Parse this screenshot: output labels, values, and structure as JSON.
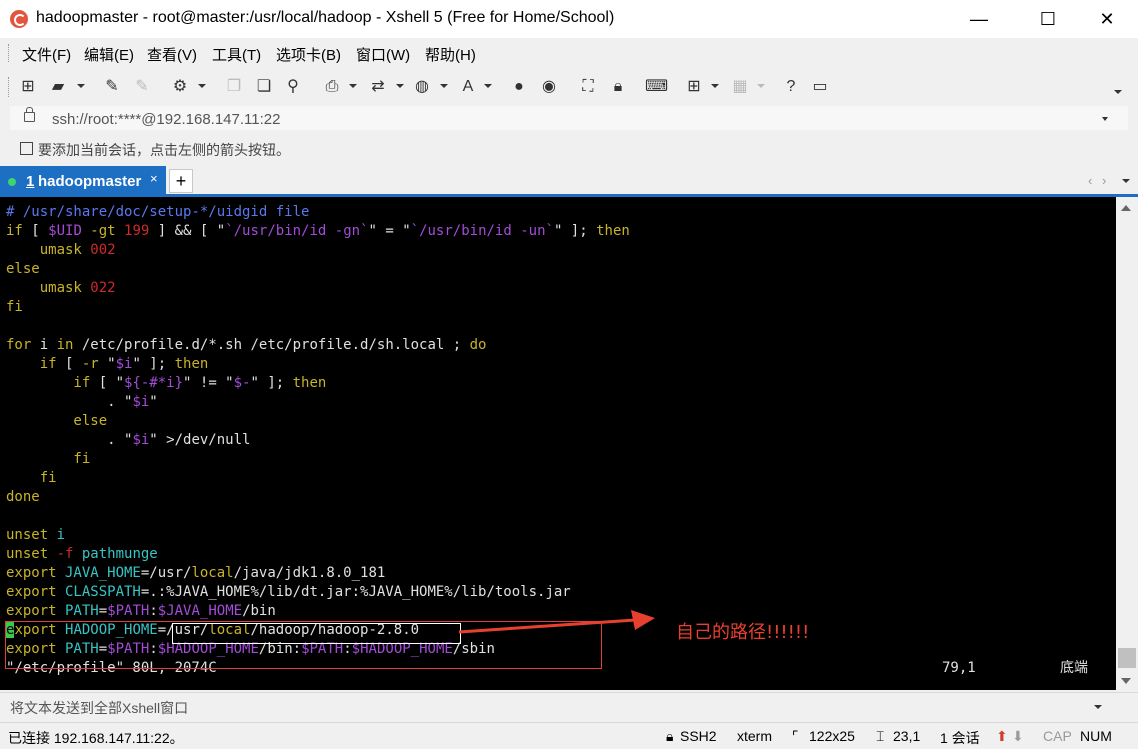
{
  "window": {
    "title": "hadoopmaster - root@master:/usr/local/hadoop - Xshell 5 (Free for Home/School)",
    "minimize": "—",
    "maximize": "☐",
    "close": "✕"
  },
  "menu": [
    "文件(F)",
    "编辑(E)",
    "查看(V)",
    "工具(T)",
    "选项卡(B)",
    "窗口(W)",
    "帮助(H)"
  ],
  "toolbar_icons": [
    "new-session-icon",
    "open-folder-icon",
    "reconnect-icon",
    "disconnect-icon",
    "properties-icon",
    "copy-icon",
    "paste-icon",
    "find-icon",
    "print-icon",
    "transfer-icon",
    "globe-icon",
    "font-icon",
    "xftp-icon",
    "xmanager-icon",
    "fullscreen-icon",
    "lock-icon",
    "keyboard-icon",
    "add-tab-icon",
    "layout-icon",
    "help-icon",
    "chat-icon"
  ],
  "address": {
    "text": "ssh://root:****@192.168.147.11:22"
  },
  "hint": {
    "text": "要添加当前会话，点击左侧的箭头按钮。"
  },
  "tab": {
    "number": "1",
    "label": "hadoopmaster",
    "close": "×",
    "add": "+"
  },
  "terminal": {
    "lines": [
      [
        {
          "t": "# /usr/share/doc/setup-*/uidgid file",
          "c": "cm"
        }
      ],
      [
        {
          "t": "if",
          "c": "kw"
        },
        {
          "t": " [ ",
          "c": "st"
        },
        {
          "t": "$UID",
          "c": "vr"
        },
        {
          "t": " -gt ",
          "c": "kw"
        },
        {
          "t": "199",
          "c": "nm"
        },
        {
          "t": " ] && [ \"",
          "c": "st"
        },
        {
          "t": "`/usr/bin/id -gn`",
          "c": "vr"
        },
        {
          "t": "\" = \"",
          "c": "st"
        },
        {
          "t": "`/usr/bin/id -un`",
          "c": "vr"
        },
        {
          "t": "\" ]; ",
          "c": "st"
        },
        {
          "t": "then",
          "c": "kw"
        }
      ],
      [
        {
          "t": "    umask ",
          "c": "kw"
        },
        {
          "t": "002",
          "c": "nm"
        }
      ],
      [
        {
          "t": "else",
          "c": "kw"
        }
      ],
      [
        {
          "t": "    umask ",
          "c": "kw"
        },
        {
          "t": "022",
          "c": "nm"
        }
      ],
      [
        {
          "t": "fi",
          "c": "kw"
        }
      ],
      [
        {
          "t": "",
          "c": "st"
        }
      ],
      [
        {
          "t": "for",
          "c": "kw"
        },
        {
          "t": " i ",
          "c": "st"
        },
        {
          "t": "in",
          "c": "kw"
        },
        {
          "t": " /etc/profile.d/*.sh /etc/profile.d/sh.local ; ",
          "c": "st"
        },
        {
          "t": "do",
          "c": "kw"
        }
      ],
      [
        {
          "t": "    if",
          "c": "kw"
        },
        {
          "t": " [ ",
          "c": "st"
        },
        {
          "t": "-r",
          "c": "kw"
        },
        {
          "t": " \"",
          "c": "st"
        },
        {
          "t": "$i",
          "c": "vr"
        },
        {
          "t": "\" ]; ",
          "c": "st"
        },
        {
          "t": "then",
          "c": "kw"
        }
      ],
      [
        {
          "t": "        if",
          "c": "kw"
        },
        {
          "t": " [ \"",
          "c": "st"
        },
        {
          "t": "${-#*i}",
          "c": "vr"
        },
        {
          "t": "\" != \"",
          "c": "st"
        },
        {
          "t": "$-",
          "c": "vr"
        },
        {
          "t": "\" ]; ",
          "c": "st"
        },
        {
          "t": "then",
          "c": "kw"
        }
      ],
      [
        {
          "t": "            . \"",
          "c": "st"
        },
        {
          "t": "$i",
          "c": "vr"
        },
        {
          "t": "\"",
          "c": "st"
        }
      ],
      [
        {
          "t": "        else",
          "c": "kw"
        }
      ],
      [
        {
          "t": "            . \"",
          "c": "st"
        },
        {
          "t": "$i",
          "c": "vr"
        },
        {
          "t": "\" >/dev/null",
          "c": "st"
        }
      ],
      [
        {
          "t": "        fi",
          "c": "kw"
        }
      ],
      [
        {
          "t": "    fi",
          "c": "kw"
        }
      ],
      [
        {
          "t": "done",
          "c": "kw"
        }
      ],
      [
        {
          "t": "",
          "c": "st"
        }
      ],
      [
        {
          "t": "unset",
          "c": "kw"
        },
        {
          "t": " i",
          "c": "pt"
        }
      ],
      [
        {
          "t": "unset",
          "c": "kw"
        },
        {
          "t": " -f ",
          "c": "nm"
        },
        {
          "t": "pathmunge",
          "c": "pt"
        }
      ],
      [
        {
          "t": "export",
          "c": "kw"
        },
        {
          "t": " JAVA_HOME",
          "c": "pt"
        },
        {
          "t": "=/usr/",
          "c": "st"
        },
        {
          "t": "local",
          "c": "kw"
        },
        {
          "t": "/java/jdk1.8.0_181",
          "c": "st"
        }
      ],
      [
        {
          "t": "export",
          "c": "kw"
        },
        {
          "t": " CLASSPATH",
          "c": "pt"
        },
        {
          "t": "=.:%JAVA_HOME%/lib/dt.jar:%JAVA_HOME%/lib/tools.jar",
          "c": "st"
        }
      ],
      [
        {
          "t": "export",
          "c": "kw"
        },
        {
          "t": " PATH",
          "c": "pt"
        },
        {
          "t": "=",
          "c": "st"
        },
        {
          "t": "$PATH",
          "c": "vr"
        },
        {
          "t": ":",
          "c": "st"
        },
        {
          "t": "$JAVA_HOME",
          "c": "vr"
        },
        {
          "t": "/bin",
          "c": "st"
        }
      ],
      [
        {
          "t": "e",
          "c": "cur"
        },
        {
          "t": "xport",
          "c": "kw"
        },
        {
          "t": " HADOOP_HOME",
          "c": "pt"
        },
        {
          "t": "=/usr/",
          "c": "st"
        },
        {
          "t": "local",
          "c": "kw"
        },
        {
          "t": "/hadoop/hadoop-2.8.0",
          "c": "st"
        }
      ],
      [
        {
          "t": "export",
          "c": "kw"
        },
        {
          "t": " PATH",
          "c": "pt"
        },
        {
          "t": "=",
          "c": "st"
        },
        {
          "t": "$PATH",
          "c": "vr"
        },
        {
          "t": ":",
          "c": "st"
        },
        {
          "t": "$HADOOP_HOME",
          "c": "vr"
        },
        {
          "t": "/bin:",
          "c": "st"
        },
        {
          "t": "$PATH",
          "c": "vr"
        },
        {
          "t": ":",
          "c": "st"
        },
        {
          "t": "$HADOOP_HOME",
          "c": "vr"
        },
        {
          "t": "/sbin",
          "c": "st"
        }
      ],
      [
        {
          "t": "\"/etc/profile\" 80L, 2074C",
          "c": "st"
        }
      ]
    ],
    "cursor_pos": "79,1",
    "mode": "底端"
  },
  "annotation": {
    "text": "自己的路径!!!!!!"
  },
  "sendbar": {
    "text": "将文本发送到全部Xshell窗口"
  },
  "status": {
    "connection": "已连接 192.168.147.11:22。",
    "protocol": "SSH2",
    "term": "xterm",
    "size": "122x25",
    "pos": "23,1",
    "sessions": "1 会话",
    "cap": "CAP",
    "num": "NUM"
  },
  "colors": {
    "accent": "#1d6fc4",
    "terminal_bg": "#000000",
    "annotation": "#e8402e"
  }
}
